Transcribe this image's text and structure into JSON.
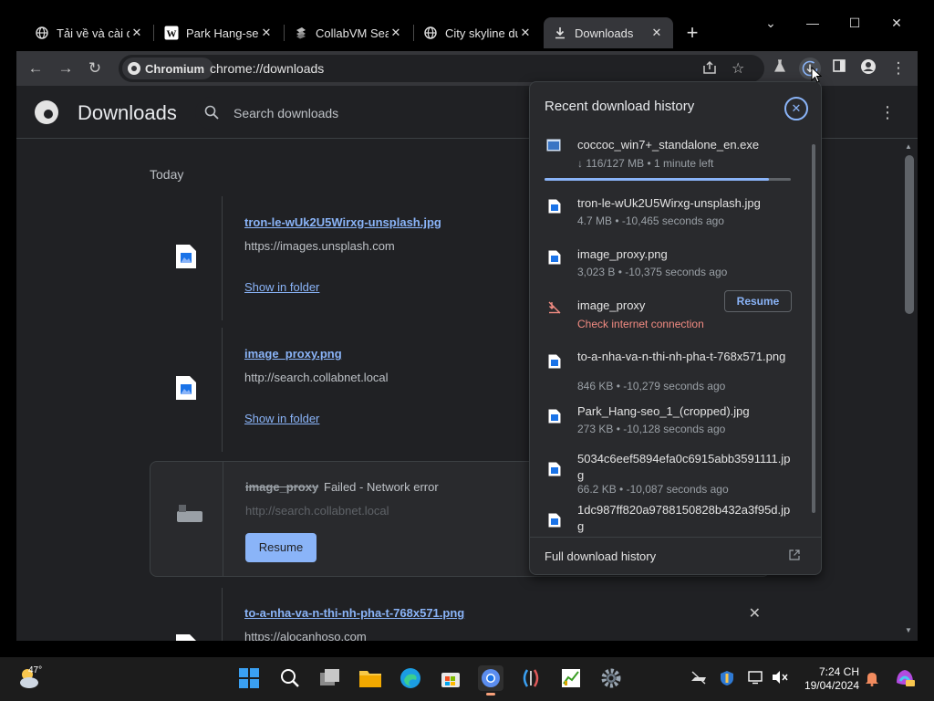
{
  "tabs": [
    {
      "title": "Tải về và cài đ",
      "icon": "globe-icon"
    },
    {
      "title": "Park Hang-seo",
      "icon": "wikipedia-icon"
    },
    {
      "title": "CollabVM Sea",
      "icon": "collabvm-icon"
    },
    {
      "title": "City skyline du",
      "icon": "globe-icon"
    },
    {
      "title": "Downloads",
      "icon": "download-icon"
    }
  ],
  "window": {
    "newtab": "+",
    "minimize": "—",
    "maximize": "☐",
    "close": "✕",
    "tabsearch": "⌄"
  },
  "toolbar": {
    "back": "←",
    "forward": "→",
    "reload": "↻",
    "chip": "Chromium",
    "url": "chrome://downloads"
  },
  "page": {
    "title": "Downloads",
    "search_placeholder": "Search downloads",
    "date_label": "Today",
    "items": [
      {
        "name": "tron-le-wUk2U5Wirxg-unsplash.jpg",
        "url": "https://images.unsplash.com",
        "action": "Show in folder"
      },
      {
        "name": "image_proxy.png",
        "url": "http://search.collabnet.local",
        "action": "Show in folder"
      },
      {
        "name": "image_proxy",
        "status": "Failed - Network error",
        "url": "http://search.collabnet.local",
        "action": "Resume"
      },
      {
        "name": "to-a-nha-va-n-thi-nh-pha-t-768x571.png",
        "url": "https://alocanhoso.com"
      }
    ]
  },
  "bubble": {
    "title": "Recent download history",
    "footer": "Full download history",
    "items": [
      {
        "name": "coccoc_win7+_standalone_en.exe",
        "meta": "↓ 116/127 MB • 1 minute left",
        "progress": 0.91
      },
      {
        "name": "tron-le-wUk2U5Wirxg-unsplash.jpg",
        "meta": "4.7 MB • -10,465 seconds ago"
      },
      {
        "name": "image_proxy.png",
        "meta": "3,023 B • -10,375 seconds ago"
      },
      {
        "name": "image_proxy",
        "error": "Check internet connection",
        "action": "Resume"
      },
      {
        "name": "to-a-nha-va-n-thi-nh-pha-t-768x571.png",
        "meta": "846 KB • -10,279 seconds ago"
      },
      {
        "name": "Park_Hang-seo_1_(cropped).jpg",
        "meta": "273 KB • -10,128 seconds ago"
      },
      {
        "name": "5034c6eef5894efa0c6915abb3591111.jpg",
        "meta": "66.2 KB • -10,087 seconds ago"
      },
      {
        "name": "1dc987ff820a9788150828b432a3f95d.jpg",
        "meta": ""
      }
    ]
  },
  "taskbar": {
    "temperature": "47°",
    "time": "7:24 CH",
    "date": "19/04/2024"
  }
}
